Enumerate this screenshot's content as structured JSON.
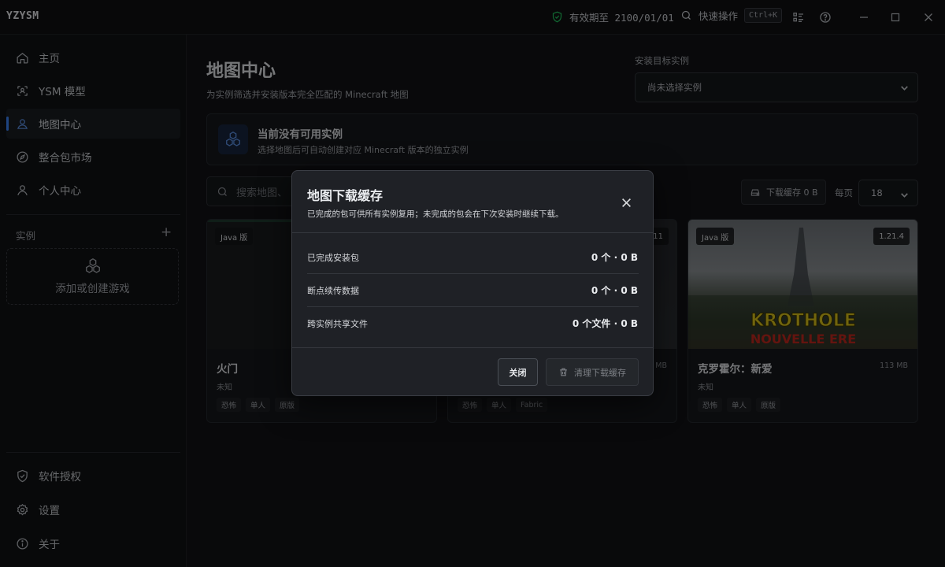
{
  "app": {
    "title": "YZYSM",
    "validity_text": "有效期至 2100/01/01",
    "quick_action_label": "快速操作",
    "quick_action_shortcut": "Ctrl+K"
  },
  "sidebar": {
    "nav": [
      {
        "label": "主页",
        "icon": "home-icon"
      },
      {
        "label": "YSM 模型",
        "icon": "scan-icon"
      },
      {
        "label": "地图中心",
        "icon": "user-map-icon",
        "active": true
      },
      {
        "label": "整合包市场",
        "icon": "compass-icon"
      },
      {
        "label": "个人中心",
        "icon": "user-icon"
      }
    ],
    "instances_label": "实例",
    "add_game_label": "添加或创建游戏",
    "bottom": [
      {
        "label": "软件授权",
        "icon": "shield-icon"
      },
      {
        "label": "设置",
        "icon": "gear-icon"
      },
      {
        "label": "关于",
        "icon": "info-icon"
      }
    ]
  },
  "main": {
    "title": "地图中心",
    "subtitle": "为实例筛选并安装版本完全匹配的 Minecraft 地图",
    "target_label": "安装目标实例",
    "target_placeholder": "尚未选择实例",
    "banner_title": "当前没有可用实例",
    "banner_subtitle": "选择地图后可自动创建对应 Minecraft 版本的独立实例",
    "search_placeholder": "搜索地图、",
    "cache_button": "下载缓存 0 B",
    "perpage_label": "每页",
    "perpage_value": "18"
  },
  "cards": [
    {
      "title": "火门",
      "edition": "Java 版",
      "version": "",
      "size": "",
      "meta": "未知",
      "tags": [
        "恐怖",
        "单人",
        "原版"
      ]
    },
    {
      "title": "",
      "edition": "",
      "version": ".11",
      "size": "3 MB",
      "meta": "",
      "tags": [
        "恐怖",
        "单人",
        "Fabric"
      ]
    },
    {
      "title": "克罗霍尔：新爱",
      "edition": "Java 版",
      "version": "1.21.4",
      "size": "113 MB",
      "meta": "未知",
      "tags": [
        "恐怖",
        "单人",
        "原版"
      ],
      "image_text_1": "KROTHOLE",
      "image_text_2": "NOUVELLE ERE"
    }
  ],
  "modal": {
    "title": "地图下载缓存",
    "description": "已完成的包可供所有实例复用；未完成的包会在下次安装时继续下载。",
    "rows": [
      {
        "label": "已完成安装包",
        "value": "0 个 · 0 B"
      },
      {
        "label": "断点续传数据",
        "value": "0 个 · 0 B"
      },
      {
        "label": "跨实例共享文件",
        "value": "0 个文件 · 0 B"
      }
    ],
    "close_button": "关闭",
    "clear_button": "清理下载缓存"
  },
  "colors": {
    "accent": "#3b82f6",
    "validity_icon": "#22c55e",
    "background": "#121316",
    "modal_bg": "#1f2126"
  }
}
